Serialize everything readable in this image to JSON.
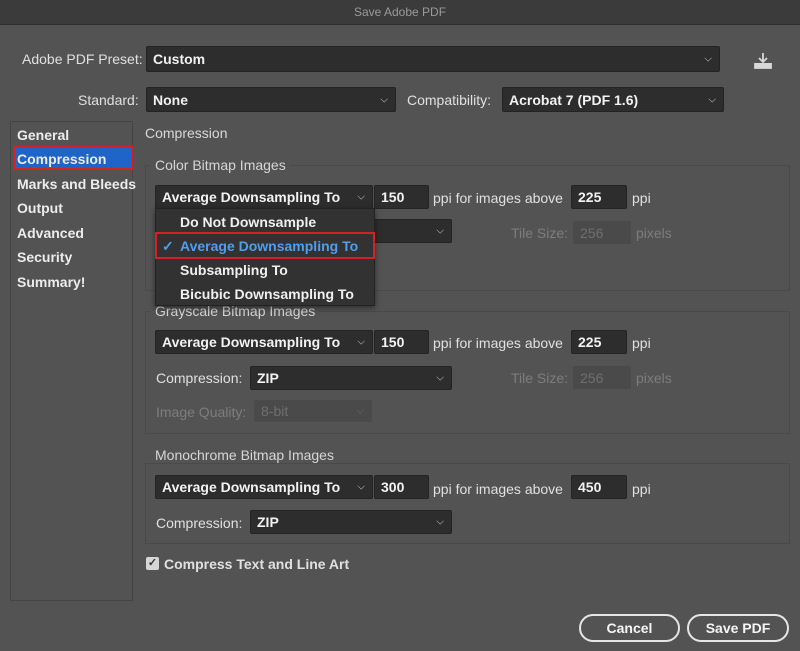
{
  "window": {
    "title": "Save Adobe PDF"
  },
  "preset": {
    "label": "Adobe PDF Preset:",
    "value": "Custom"
  },
  "standard": {
    "label": "Standard:",
    "value": "None"
  },
  "compatibility": {
    "label": "Compatibility:",
    "value": "Acrobat 7 (PDF 1.6)"
  },
  "sidebar": {
    "selected_index": 1,
    "items": [
      {
        "label": "General"
      },
      {
        "label": "Compression"
      },
      {
        "label": "Marks and Bleeds"
      },
      {
        "label": "Output"
      },
      {
        "label": "Advanced"
      },
      {
        "label": "Security"
      },
      {
        "label": "Summary!"
      }
    ]
  },
  "section_title": "Compression",
  "color": {
    "title": "Color Bitmap Images",
    "downsampling": "Average Downsampling To",
    "ppi": "150",
    "above_label": "ppi for images above",
    "above_value": "225",
    "ppi_unit": "ppi",
    "tile_label": "Tile Size:",
    "tile_value": "256",
    "tile_unit": "pixels"
  },
  "dropdown_menu": {
    "selected_index": 1,
    "checkmark": "✓",
    "options": [
      "Do Not Downsample",
      "Average Downsampling To",
      "Subsampling To",
      "Bicubic Downsampling To"
    ]
  },
  "grayscale": {
    "title": "Grayscale Bitmap Images",
    "downsampling": "Average Downsampling To",
    "ppi": "150",
    "above_label": "ppi for images above",
    "above_value": "225",
    "ppi_unit": "ppi",
    "compression_label": "Compression:",
    "compression_value": "ZIP",
    "tile_label": "Tile Size:",
    "tile_value": "256",
    "tile_unit": "pixels",
    "quality_label": "Image Quality:",
    "quality_value": "8-bit"
  },
  "monochrome": {
    "title": "Monochrome Bitmap Images",
    "downsampling": "Average Downsampling To",
    "ppi": "300",
    "above_label": "ppi for images above",
    "above_value": "450",
    "ppi_unit": "ppi",
    "compression_label": "Compression:",
    "compression_value": "ZIP"
  },
  "compress_text": {
    "label": "Compress Text and Line Art",
    "checked": true
  },
  "buttons": {
    "cancel": "Cancel",
    "save": "Save PDF"
  },
  "icons": {
    "save_preset": "download-tray-icon",
    "chevron": "chevron-down-icon",
    "check": "checkmark-icon"
  }
}
